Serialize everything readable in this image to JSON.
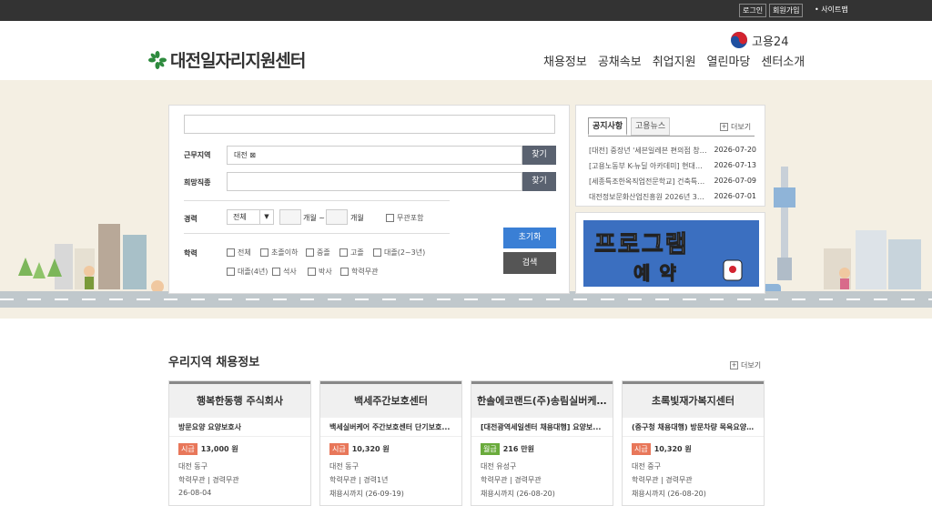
{
  "topbar": {
    "login": "로그인",
    "signup": "회원가입",
    "sitemap": "• 사이트맵"
  },
  "header": {
    "logo": "대전일자리지원센터",
    "emblem": "고용24",
    "nav": [
      "채용정보",
      "공채속보",
      "취업지원",
      "열린마당",
      "센터소개"
    ]
  },
  "search": {
    "keyword_value": "",
    "region_label": "근무지역",
    "region_value": "대전 ⊠",
    "find_label": "찾기",
    "job_label": "희망직종",
    "career_label": "경력",
    "career_select": "전체",
    "month_from": "개월 ~",
    "month_to": "개월",
    "career_none": "무관포함",
    "edu_label": "학력",
    "edu_options": [
      "전체",
      "초졸이하",
      "중졸",
      "고졸",
      "대졸(2~3년)",
      "대졸(4년)",
      "석사",
      "박사",
      "학력무관"
    ],
    "reset": "초기화",
    "submit": "검색"
  },
  "news": {
    "tabs": [
      "공지사항",
      "고용뉴스"
    ],
    "more": "더보기",
    "items": [
      {
        "title": "[대전] 중장년 '세븐일레븐 편의점 창업설...",
        "date": "2026-07-20"
      },
      {
        "title": "[고용노동부 K-뉴딜 아카데미] 현대홈쇼핑...",
        "date": "2026-07-13"
      },
      {
        "title": "[세종특조한옥직업전문학교] 건축특공 한...",
        "date": "2026-07-09"
      },
      {
        "title": "대전정보문화산업진흥원 2026년 3차 사...",
        "date": "2026-07-01"
      }
    ]
  },
  "banner": {
    "line1": "프로그램",
    "line2": "예약"
  },
  "jobs": {
    "title": "우리지역 채용정보",
    "more": "더보기",
    "cards": [
      {
        "company": "행복한동행 주식회사",
        "job": "방문요양 요양보호사",
        "pay_type": "시급",
        "pay": "13,000 원",
        "location": "대전 동구",
        "req": "학력무관 | 경력무관",
        "deadline": "26-08-04"
      },
      {
        "company": "백세주간보호센터",
        "job": "백세실버케어 주간보호센터 단기보호...",
        "pay_type": "시급",
        "pay": "10,320 원",
        "location": "대전 동구",
        "req": "학력무관 | 경력1년",
        "deadline": "채용시까지 (26-09-19)"
      },
      {
        "company": "한솔에코랜드(주)송림실버케어...",
        "job": "[대전광역세일센터 채용대행] 요양보...",
        "pay_type": "월급",
        "pay": "216 만원",
        "location": "대전 유성구",
        "req": "학력무관 | 경력무관",
        "deadline": "채용시까지 (26-08-20)"
      },
      {
        "company": "초록빛재가복지센터",
        "job": "(중구청 채용대행) 방문차량 목욕요양...",
        "pay_type": "시급",
        "pay": "10,320 원",
        "location": "대전 중구",
        "req": "학력무관 | 경력무관",
        "deadline": "채용시까지 (26-08-20)"
      }
    ]
  },
  "colors": {
    "topbar": "#333333",
    "hero": "#f4efe3",
    "accent": "#3a7fd5",
    "hourly": "#e8775a",
    "monthly": "#6aab3c"
  }
}
